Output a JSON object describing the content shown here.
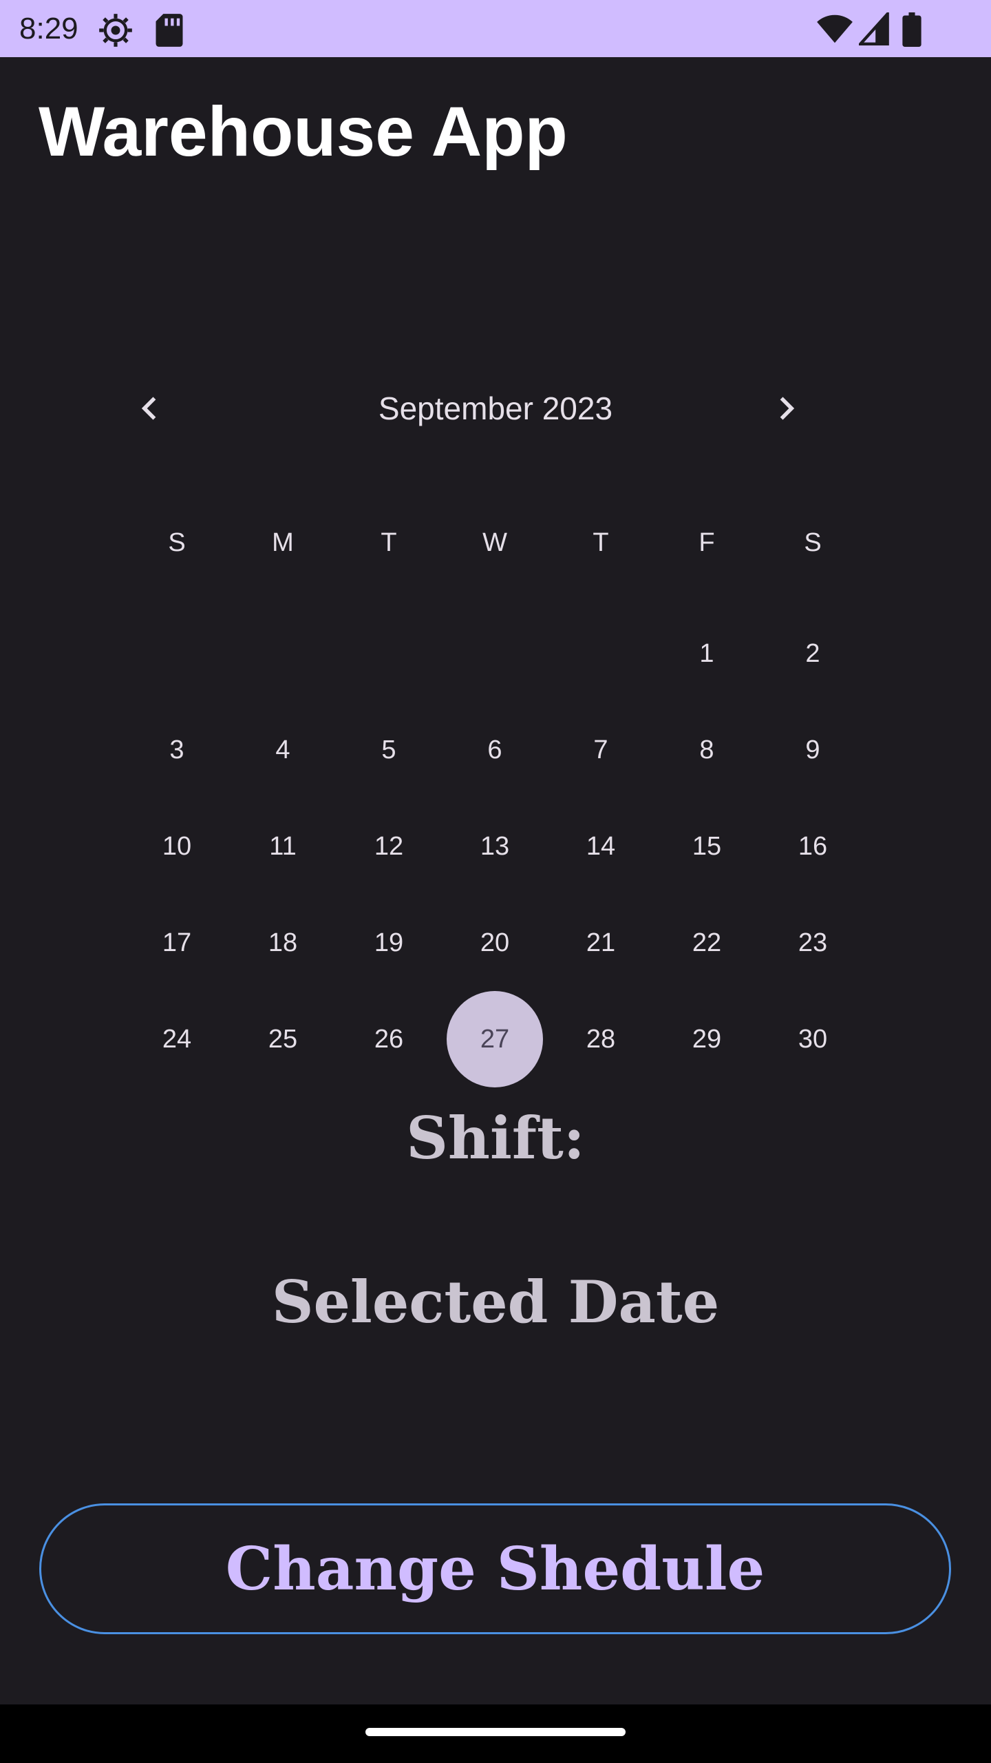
{
  "status_bar": {
    "time": "8:29",
    "left_icons": [
      "settings-gear-icon",
      "sd-card-icon"
    ],
    "right_icons": [
      "wifi-icon",
      "cell-signal-icon",
      "battery-icon"
    ],
    "background": "#d0bcff"
  },
  "app": {
    "title": "Warehouse App"
  },
  "calendar": {
    "month_label": "September 2023",
    "prev_icon": "chevron-left-icon",
    "next_icon": "chevron-right-icon",
    "weekdays": [
      "S",
      "M",
      "T",
      "W",
      "T",
      "F",
      "S"
    ],
    "days": [
      "",
      "",
      "",
      "",
      "",
      "1",
      "2",
      "3",
      "4",
      "5",
      "6",
      "7",
      "8",
      "9",
      "10",
      "11",
      "12",
      "13",
      "14",
      "15",
      "16",
      "17",
      "18",
      "19",
      "20",
      "21",
      "22",
      "23",
      "24",
      "25",
      "26",
      "27",
      "28",
      "29",
      "30"
    ],
    "selected_day": "27",
    "selected_color": "#ccc2dc"
  },
  "shift": {
    "label": "Shift:"
  },
  "selected_date": {
    "label": "Selected Date"
  },
  "actions": {
    "change_schedule_label": "Change Shedule",
    "accent": "#d0bcff",
    "border_color": "#4a90e2"
  }
}
